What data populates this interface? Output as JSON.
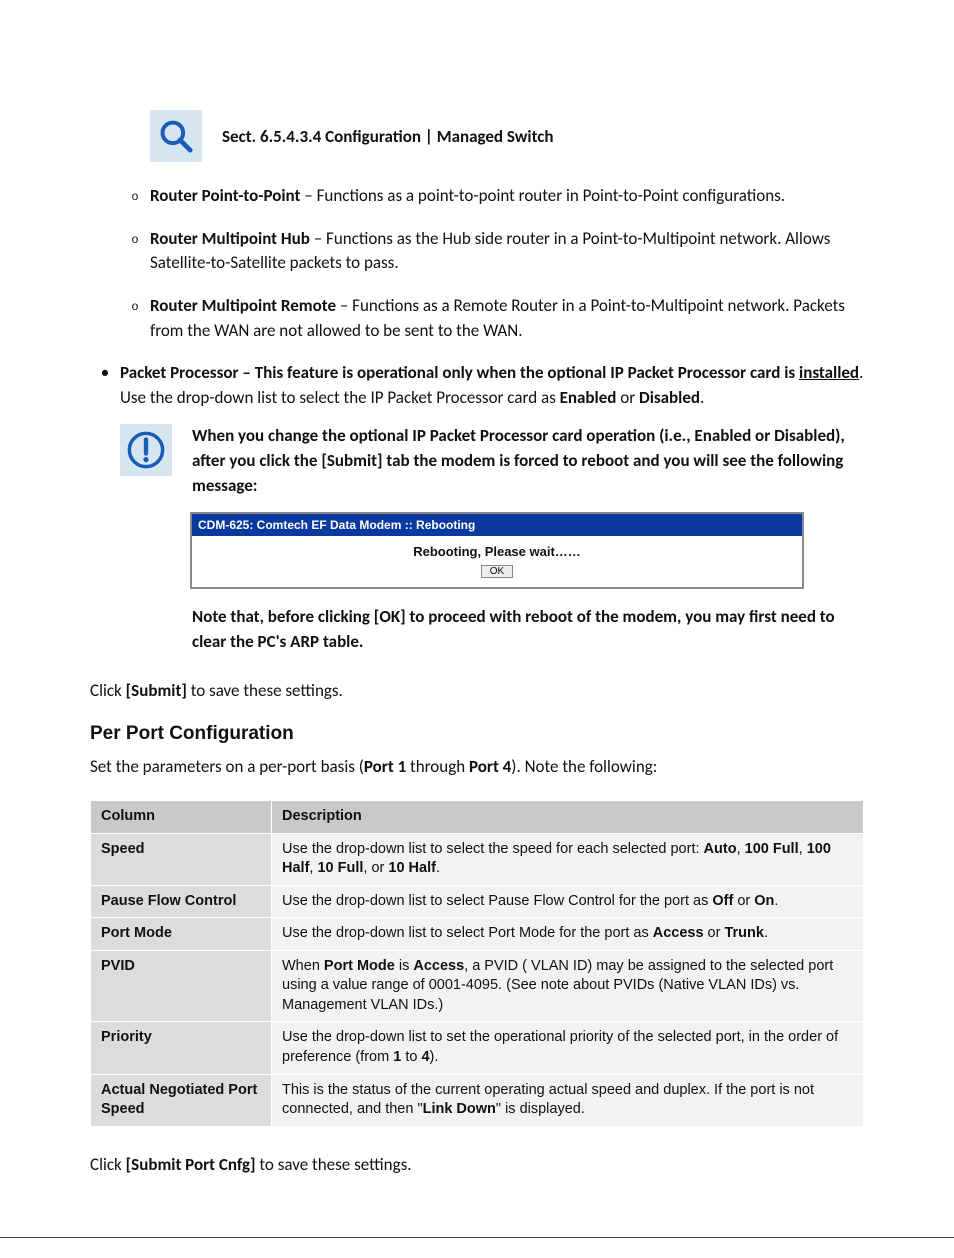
{
  "section_title": "Sect. 6.5.4.3.4 Configuration | Managed Switch",
  "bullets_circ": [
    {
      "strong": "Router Point-to-Point",
      "rest": " – Functions as a point-to-point router in Point-to-Point configurations."
    },
    {
      "strong": "Router Multipoint Hub",
      "rest": " – Functions as the Hub side router in a Point-to-Multipoint network. Allows Satellite-to-Satellite packets to pass."
    },
    {
      "strong": "Router Multipoint Remote",
      "rest": " – Functions as a Remote Router in a Point-to-Multipoint network. Packets from the WAN are not allowed to be sent to the WAN."
    }
  ],
  "processor": {
    "lead_bold": "Packet Processor – This feature is operational only when the optional IP Packet Processor card is ",
    "underlined": "installed",
    "mid": ". Use the drop-down list to select the IP Packet Processor card as ",
    "enabled": "Enabled",
    "or": " or ",
    "disabled": "Disabled",
    "dot": "."
  },
  "alert_text": "When you change the optional IP Packet Processor card operation (i.e., Enabled or Disabled), after you click the [Submit] tab the modem is forced to reboot and you will see the following message:",
  "reboot": {
    "title": "CDM-625: Comtech EF Data Modem :: Rebooting",
    "message": "Rebooting, Please wait……",
    "ok": "OK"
  },
  "note_text": "Note that, before clicking [OK] to proceed with reboot of the modem, you may first need to clear the PC's ARP table.",
  "submit_line": {
    "pre": "Click ",
    "btn": "[Submit]",
    "post": " to save these settings."
  },
  "per_port_header": "Per Port Configuration",
  "per_port_intro": {
    "pre": "Set the parameters on a per-port basis (",
    "p1": "Port 1",
    "mid": " through ",
    "p4": "Port 4",
    "post": "). Note the following:"
  },
  "table": {
    "headers": {
      "c1": "Column",
      "c2": "Description"
    },
    "rows": [
      {
        "k": "Speed",
        "v_pre": "Use the drop-down list to select the speed for each selected port: ",
        "v_b1": "Auto",
        "v_s1": ", ",
        "v_b2": "100 Full",
        "v_s2": ", ",
        "v_b3": "100 Half",
        "v_s3": ", ",
        "v_b4": "10 Full",
        "v_s4": ", or ",
        "v_b5": "10 Half",
        "v_post": "."
      },
      {
        "k": "Pause Flow Control",
        "v_pre": "Use the drop-down list to select Pause Flow Control for the port as ",
        "v_b1": "Off",
        "v_s1": " or ",
        "v_b2": "On",
        "v_post": "."
      },
      {
        "k": "Port Mode",
        "v_pre": "Use the drop-down list to select Port Mode for the port as ",
        "v_b1": "Access",
        "v_s1": " or ",
        "v_b2": "Trunk",
        "v_post": "."
      },
      {
        "k": "PVID",
        "v_pre": "When ",
        "v_b1": "Port Mode",
        "v_s1": " is ",
        "v_b2": "Access",
        "v_s2": ", a PVID (          VLAN ID) may be assigned to the selected port using a value range of 0001-4095. (See note about PVIDs (Native VLAN IDs) vs. Management VLAN IDs.)"
      },
      {
        "k": "Priority",
        "v_pre": "Use the drop-down list to set the operational priority of the selected port, in the order of preference (from ",
        "v_b1": "1",
        "v_s1": " to ",
        "v_b2": "4",
        "v_post": ")."
      },
      {
        "k": "Actual Negotiated Port Speed",
        "v_pre": "This is the status of the current operating actual speed and duplex. If the port is not connected, and then \"",
        "v_b1": "Link Down",
        "v_post": "\" is displayed."
      }
    ]
  },
  "submit_port_line": {
    "pre": "Click ",
    "btn": "[Submit Port Cnfg]",
    "post": " to save these settings."
  }
}
